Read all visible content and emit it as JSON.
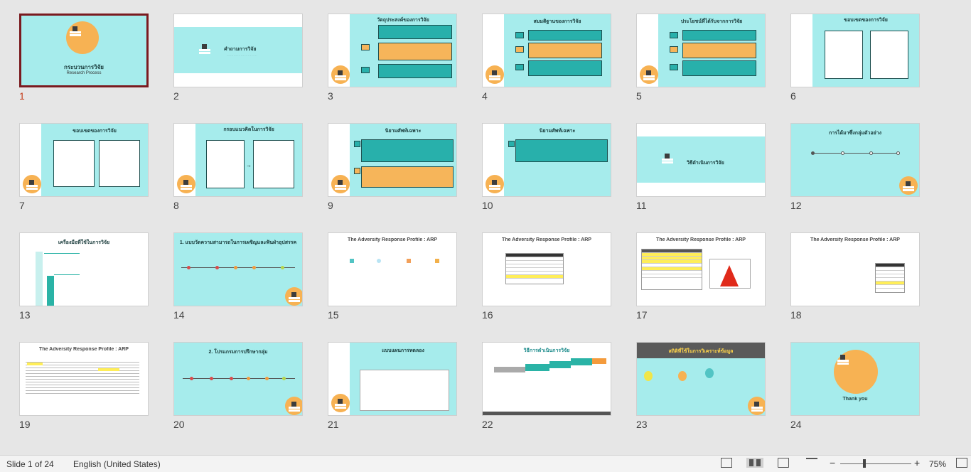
{
  "status": {
    "slide_info": "Slide 1 of 24",
    "language": "English (United States)",
    "zoom": "75%",
    "zoom_minus": "−",
    "zoom_plus": "+"
  },
  "slides": [
    {
      "num": "1",
      "title": "กระบวนการวิจัย",
      "sub": "Research Process"
    },
    {
      "num": "2",
      "title": "คำถามการวิจัย",
      "sub": ""
    },
    {
      "num": "3",
      "title": "วัตถุประสงค์ของการวิจัย",
      "sub": ""
    },
    {
      "num": "4",
      "title": "สมมติฐานของการวิจัย",
      "sub": ""
    },
    {
      "num": "5",
      "title": "ประโยชน์ที่ได้รับจากการวิจัย",
      "sub": ""
    },
    {
      "num": "6",
      "title": "ขอบเขตของการวิจัย",
      "sub": ""
    },
    {
      "num": "7",
      "title": "ขอบเขตของการวิจัย",
      "sub": ""
    },
    {
      "num": "8",
      "title": "กรอบแนวคิดในการวิจัย",
      "sub": ""
    },
    {
      "num": "9",
      "title": "นิยามศัพท์เฉพาะ",
      "sub": ""
    },
    {
      "num": "10",
      "title": "นิยามศัพท์เฉพาะ",
      "sub": ""
    },
    {
      "num": "11",
      "title": "วิธีดำเนินการวิจัย",
      "sub": ""
    },
    {
      "num": "12",
      "title": "การได้มาซึ่งกลุ่มตัวอย่าง",
      "sub": ""
    },
    {
      "num": "13",
      "title": "เครื่องมือที่ใช้ในการวิจัย",
      "sub": ""
    },
    {
      "num": "14",
      "title": "1. แบบวัดความสามารถในการเผชิญและฟันฝ่าอุปสรรค",
      "sub": ""
    },
    {
      "num": "15",
      "title": "The Adversity Response Profile : ARP",
      "sub": ""
    },
    {
      "num": "16",
      "title": "The Adversity Response Profile : ARP",
      "sub": ""
    },
    {
      "num": "17",
      "title": "The Adversity Response Profile : ARP",
      "sub": ""
    },
    {
      "num": "18",
      "title": "The Adversity Response Profile : ARP",
      "sub": ""
    },
    {
      "num": "19",
      "title": "The Adversity Response Profile : ARP",
      "sub": ""
    },
    {
      "num": "20",
      "title": "2. โปรแกรมการปรึกษากลุ่ม",
      "sub": ""
    },
    {
      "num": "21",
      "title": "แบบแผนการทดลอง",
      "sub": ""
    },
    {
      "num": "22",
      "title": "วิธีการดำเนินการวิจัย",
      "sub": ""
    },
    {
      "num": "23",
      "title": "สถิติที่ใช้ในการวิเคราะห์ข้อมูล",
      "sub": ""
    },
    {
      "num": "24",
      "title": "Thank you",
      "sub": ""
    }
  ]
}
